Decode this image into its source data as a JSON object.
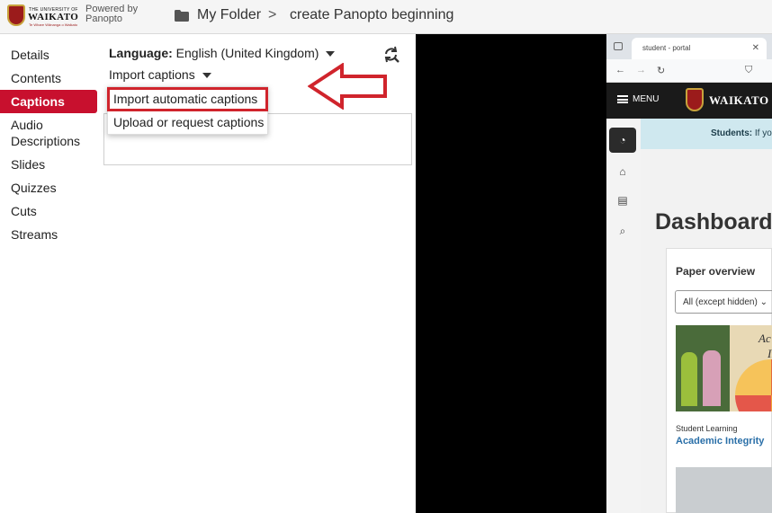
{
  "header": {
    "logo": {
      "small_text": "THE UNIVERSITY OF",
      "name": "WAIKATO",
      "motto": "Te Whare Wānanga o Waikato"
    },
    "powered_by": [
      "Powered by",
      "Panopto"
    ],
    "breadcrumb": {
      "folder": "My Folder",
      "separator": ">",
      "session": "create Panopto beginning"
    }
  },
  "nav": {
    "items": [
      {
        "label": "Details",
        "active": false
      },
      {
        "label": "Contents",
        "active": false
      },
      {
        "label": "Captions",
        "active": true
      },
      {
        "label": "Audio Descriptions",
        "active": false
      },
      {
        "label": "Slides",
        "active": false
      },
      {
        "label": "Quizzes",
        "active": false
      },
      {
        "label": "Cuts",
        "active": false
      },
      {
        "label": "Streams",
        "active": false
      }
    ]
  },
  "captions": {
    "language_label": "Language:",
    "language_value": "English (United Kingdom)",
    "import_label": "Import captions",
    "menu": [
      {
        "label": "Import automatic captions",
        "highlighted": true
      },
      {
        "label": "Upload or request captions",
        "highlighted": false
      }
    ]
  },
  "annotation": {
    "arrow_color": "#d0242c"
  },
  "video": {
    "browser_tab": "student - portal",
    "site": {
      "menu_label": "MENU",
      "name": "WAIKATO",
      "banner_bold": "Students:",
      "banner_text": "If yo",
      "dashboard_title": "Dashboard",
      "card_title": "Paper overview",
      "filter": "All (except hidden)",
      "course_art_text": [
        "Ac",
        "In"
      ],
      "course_category": "Student Learning",
      "course_link": "Academic Integrity"
    }
  },
  "colors": {
    "accent": "#c8102e",
    "highlight_border": "#d0242c"
  }
}
